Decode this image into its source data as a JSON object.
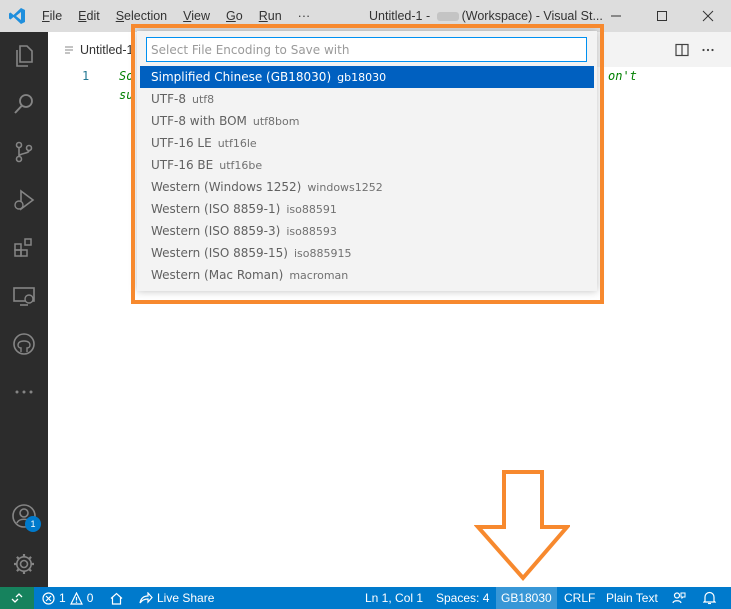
{
  "titlebar": {
    "menu": [
      {
        "pre": "",
        "u": "F",
        "post": "ile"
      },
      {
        "pre": "",
        "u": "E",
        "post": "dit"
      },
      {
        "pre": "",
        "u": "S",
        "post": "election"
      },
      {
        "pre": "",
        "u": "V",
        "post": "iew"
      },
      {
        "pre": "",
        "u": "G",
        "post": "o"
      },
      {
        "pre": "",
        "u": "R",
        "post": "un"
      }
    ],
    "more": "···",
    "title_prefix": "Untitled-1 - ",
    "title_suffix": "(Workspace) - Visual St..."
  },
  "tab": {
    "label": "Untitled-1"
  },
  "editor": {
    "line_number": "1",
    "line1_left": "So",
    "line1_right": "on't",
    "line2_left": "su"
  },
  "quickpick": {
    "placeholder": "Select File Encoding to Save with",
    "items": [
      {
        "label": "Simplified Chinese (GB18030)",
        "desc": "gb18030",
        "selected": true
      },
      {
        "label": "UTF-8",
        "desc": "utf8"
      },
      {
        "label": "UTF-8 with BOM",
        "desc": "utf8bom"
      },
      {
        "label": "UTF-16 LE",
        "desc": "utf16le"
      },
      {
        "label": "UTF-16 BE",
        "desc": "utf16be"
      },
      {
        "label": "Western (Windows 1252)",
        "desc": "windows1252"
      },
      {
        "label": "Western (ISO 8859-1)",
        "desc": "iso88591"
      },
      {
        "label": "Western (ISO 8859-3)",
        "desc": "iso88593"
      },
      {
        "label": "Western (ISO 8859-15)",
        "desc": "iso885915"
      },
      {
        "label": "Western (Mac Roman)",
        "desc": "macroman"
      }
    ]
  },
  "activitybar": {
    "account_badge": "1"
  },
  "statusbar": {
    "errors": "1",
    "warnings": "0",
    "live_share": "Live Share",
    "position": "Ln 1, Col 1",
    "spaces": "Spaces: 4",
    "encoding": "GB18030",
    "eol": "CRLF",
    "language": "Plain Text"
  },
  "colors": {
    "accent": "#007acc",
    "selection": "#0060c0",
    "annotation": "#f7892e",
    "remote": "#16825d"
  }
}
